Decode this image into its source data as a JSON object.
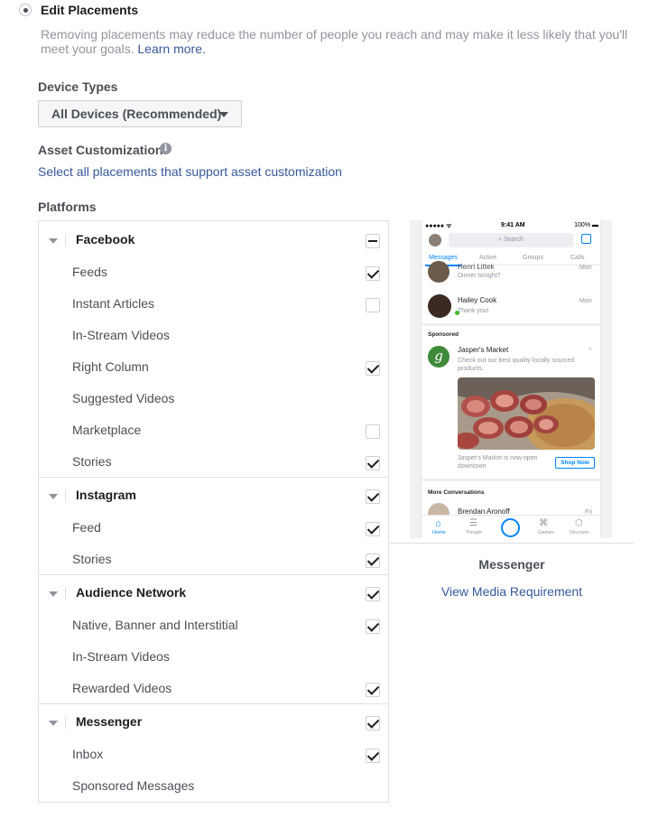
{
  "header": {
    "title": "Edit Placements",
    "description": "Removing placements may reduce the number of people you reach and may make it less likely that you'll meet your goals.",
    "learn_more": "Learn more."
  },
  "device_types": {
    "label": "Device Types",
    "selected": "All Devices (Recommended)"
  },
  "asset_customization": {
    "label": "Asset Customization",
    "link": "Select all placements that support asset customization"
  },
  "platforms": {
    "label": "Platforms",
    "groups": [
      {
        "name": "Facebook",
        "state": "partial",
        "items": [
          {
            "label": "Feeds",
            "state": "checked"
          },
          {
            "label": "Instant Articles",
            "state": "unchecked"
          },
          {
            "label": "In-Stream Videos",
            "state": "none"
          },
          {
            "label": "Right Column",
            "state": "checked"
          },
          {
            "label": "Suggested Videos",
            "state": "none"
          },
          {
            "label": "Marketplace",
            "state": "unchecked"
          },
          {
            "label": "Stories",
            "state": "checked"
          }
        ]
      },
      {
        "name": "Instagram",
        "state": "checked",
        "items": [
          {
            "label": "Feed",
            "state": "checked"
          },
          {
            "label": "Stories",
            "state": "checked"
          }
        ]
      },
      {
        "name": "Audience Network",
        "state": "checked",
        "items": [
          {
            "label": "Native, Banner and Interstitial",
            "state": "checked"
          },
          {
            "label": "In-Stream Videos",
            "state": "none"
          },
          {
            "label": "Rewarded Videos",
            "state": "checked"
          }
        ]
      },
      {
        "name": "Messenger",
        "state": "checked",
        "items": [
          {
            "label": "Inbox",
            "state": "checked"
          },
          {
            "label": "Sponsored Messages",
            "state": "none"
          }
        ]
      }
    ]
  },
  "preview": {
    "title": "Messenger",
    "link": "View Media Requirement",
    "phone": {
      "time": "9:41 AM",
      "battery": "100%",
      "search_placeholder": "Search",
      "tabs": [
        "Messages",
        "Active",
        "Groups",
        "Calls"
      ],
      "conversations": [
        {
          "name": "Henri Littek",
          "message": "Dinner tonight?",
          "time": "Mon"
        },
        {
          "name": "Hailey Cook",
          "message": "Thank you!",
          "time": "Mon"
        }
      ],
      "sponsored_label": "Sponsored",
      "ad": {
        "brand": "Jasper's Market",
        "text": "Check out our best quality locally sourced products.",
        "caption": "Jasper's Market is now open downtown",
        "cta": "Shop Now"
      },
      "more_label": "More Conversations",
      "more_conversation": {
        "name": "Brendan Aronoff",
        "time": "Fri"
      },
      "nav": [
        "Home",
        "People",
        "Games",
        "Discover"
      ]
    }
  }
}
